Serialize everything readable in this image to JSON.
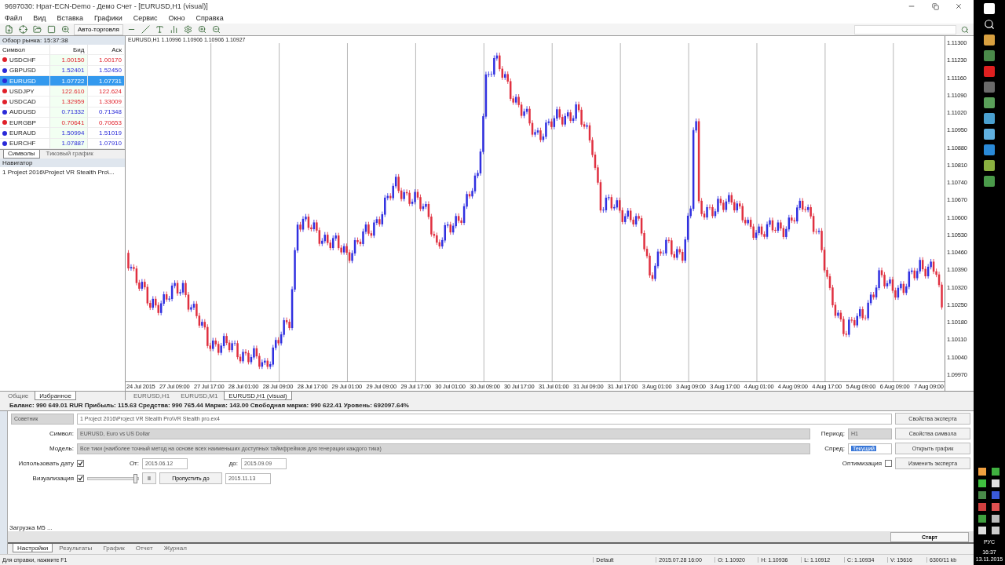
{
  "window": {
    "title": "9697030: Нрат-ECN-Demo - Демо Счет - [EURUSD,H1 (visual)]"
  },
  "menu": [
    "Файл",
    "Вид",
    "Вставка",
    "Графики",
    "Сервис",
    "Окно",
    "Справка"
  ],
  "toolbar": {
    "autotrade": "Авто-торговля"
  },
  "market_watch": {
    "title": "Обзор рынка: 15:37:38",
    "columns": [
      "Символ",
      "Бид",
      "Аск"
    ],
    "rows": [
      {
        "symbol": "USDCHF",
        "bid": "1.00150",
        "ask": "1.00170",
        "color": "#e0202a",
        "selected": false
      },
      {
        "symbol": "GBPUSD",
        "bid": "1.52401",
        "ask": "1.52450",
        "color": "#2a2ad8",
        "selected": false
      },
      {
        "symbol": "EURUSD",
        "bid": "1.07722",
        "ask": "1.07731",
        "color": "#2a2ad8",
        "selected": true
      },
      {
        "symbol": "USDJPY",
        "bid": "122.610",
        "ask": "122.624",
        "color": "#e0202a",
        "selected": false
      },
      {
        "symbol": "USDCAD",
        "bid": "1.32959",
        "ask": "1.33009",
        "color": "#e0202a",
        "selected": false
      },
      {
        "symbol": "AUDUSD",
        "bid": "0.71332",
        "ask": "0.71348",
        "color": "#2a2ad8",
        "selected": false
      },
      {
        "symbol": "EURGBP",
        "bid": "0.70641",
        "ask": "0.70653",
        "color": "#e0202a",
        "selected": false
      },
      {
        "symbol": "EURAUD",
        "bid": "1.50994",
        "ask": "1.51019",
        "color": "#2a2ad8",
        "selected": false
      },
      {
        "symbol": "EURCHF",
        "bid": "1.07887",
        "ask": "1.07910",
        "color": "#2a2ad8",
        "selected": false
      }
    ],
    "tabs": [
      {
        "label": "Символы",
        "selected": true
      },
      {
        "label": "Тиковый график",
        "selected": false
      }
    ]
  },
  "navigator": {
    "title": "Навигатор",
    "items": [
      "1 Project 2016\\Project VR Stealth Pro\\..."
    ],
    "tabs": [
      {
        "label": "Общие",
        "selected": false
      },
      {
        "label": "Избранное",
        "selected": true
      }
    ]
  },
  "chart": {
    "header": "EURUSD,H1  1.10996 1.10906 1.10906 1.10927",
    "price_labels": [
      "1.11300",
      "1.11230",
      "1.11160",
      "1.11090",
      "1.11020",
      "1.10950",
      "1.10880",
      "1.10810",
      "1.10740",
      "1.10670",
      "1.10600",
      "1.10530",
      "1.10460",
      "1.10390",
      "1.10320",
      "1.10250",
      "1.10180",
      "1.10110",
      "1.10040",
      "1.09970"
    ],
    "time_labels": [
      "24 Jul 2015",
      "27 Jul 09:00",
      "27 Jul 17:00",
      "28 Jul 01:00",
      "28 Jul 09:00",
      "28 Jul 17:00",
      "29 Jul 01:00",
      "29 Jul 09:00",
      "29 Jul 17:00",
      "30 Jul 01:00",
      "30 Jul 09:00",
      "30 Jul 17:00",
      "31 Jul 01:00",
      "31 Jul 09:00",
      "31 Jul 17:00",
      "3 Aug 01:00",
      "3 Aug 09:00",
      "3 Aug 17:00",
      "4 Aug 01:00",
      "4 Aug 09:00",
      "4 Aug 17:00",
      "5 Aug 09:00",
      "6 Aug 09:00",
      "7 Aug 09:00"
    ],
    "tabs": [
      {
        "label": "EURUSD,H1",
        "selected": false
      },
      {
        "label": "EURUSD,M1",
        "selected": false
      },
      {
        "label": "EURUSD,H1 (visual)",
        "selected": true
      }
    ]
  },
  "account_line": "Баланс: 990 649.01 RUR  Прибыль: 115.63  Средства: 990 765.44  Маржа: 143.00  Свободная маржа: 990 622.41  Уровень: 692097.64%",
  "tester": {
    "mode": "Советник",
    "expert": "1 Project 2016\\Project VR Stealth Pro\\VR Stealth pro.ex4",
    "symbol_label": "Символ:",
    "symbol": "EURUSD, Euro vs US Dollar",
    "model_label": "Модель:",
    "model": "Все тики (наиболее точный метод на основе всех наименьших доступных таймфреймов для генерации каждого тика)",
    "period_label": "Период:",
    "period": "H1",
    "spread_label": "Спред:",
    "spread": "Текущий",
    "use_date_label": "Использовать дату",
    "use_date": true,
    "from_label": "От:",
    "from": "2015.06.12",
    "to_label": "до:",
    "to": "2015.09.09",
    "visual_label": "Визуализация",
    "visual": true,
    "speed": {
      "level": 0.95
    },
    "pause": "II",
    "skip_button": "Пропустить до",
    "skip_date": "2015.11.13",
    "optimization_label": "Оптимизация",
    "optimization": false,
    "buttons": [
      "Свойства эксперта",
      "Свойства символа",
      "Открыть график",
      "Изменить эксперта"
    ],
    "loading": "Загрузка M5 ...",
    "start": "Старт",
    "tabs": [
      {
        "label": "Настройки",
        "selected": true
      },
      {
        "label": "Результаты",
        "selected": false
      },
      {
        "label": "График",
        "selected": false
      },
      {
        "label": "Отчет",
        "selected": false
      },
      {
        "label": "Журнал",
        "selected": false
      }
    ]
  },
  "status_bar": [
    "Для справки, нажмите F1",
    "Default",
    "2015.07.28 16:00",
    "O: 1.10920",
    "H: 1.10936",
    "L: 1.10912",
    "C: 1.10934",
    "V: 15616",
    "6300/11 kb"
  ],
  "taskbar": {
    "language": "РУС",
    "time": "16:37",
    "date": "13.11.2015"
  }
}
